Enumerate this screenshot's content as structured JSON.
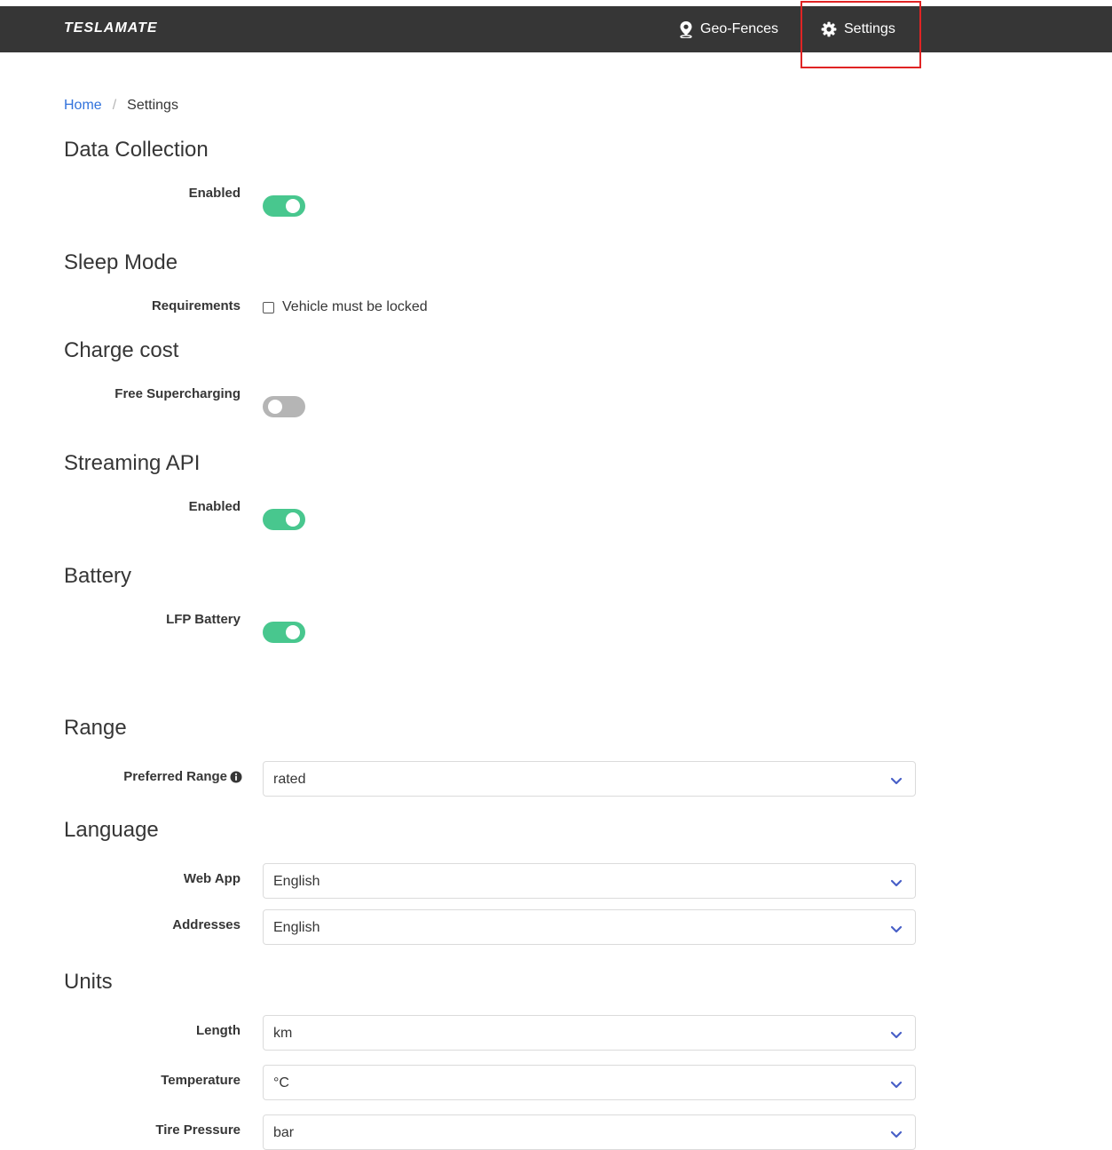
{
  "navbar": {
    "brand": "TESLAMATE",
    "geofences_label": "Geo-Fences",
    "settings_label": "Settings",
    "text_color": "#ffffff",
    "background": "#363636"
  },
  "breadcrumb": {
    "home": "Home",
    "separator": "/",
    "current": "Settings"
  },
  "sections": {
    "data_collection": {
      "title": "Data Collection",
      "enabled_label": "Enabled",
      "enabled": true
    },
    "sleep_mode": {
      "title": "Sleep Mode",
      "requirements_label": "Requirements",
      "vehicle_locked_label": "Vehicle must be locked",
      "vehicle_locked_checked": false
    },
    "charge_cost": {
      "title": "Charge cost",
      "free_supercharging_label": "Free Supercharging",
      "free_supercharging": false
    },
    "streaming_api": {
      "title": "Streaming API",
      "enabled_label": "Enabled",
      "enabled": true
    },
    "battery": {
      "title": "Battery",
      "lfp_label": "LFP Battery",
      "lfp": true
    },
    "range": {
      "title": "Range",
      "preferred_range_label": "Preferred Range",
      "preferred_range_value": "rated"
    },
    "language": {
      "title": "Language",
      "web_app_label": "Web App",
      "web_app_value": "English",
      "addresses_label": "Addresses",
      "addresses_value": "English"
    },
    "units": {
      "title": "Units",
      "length_label": "Length",
      "length_value": "km",
      "temperature_label": "Temperature",
      "temperature_value": "°C",
      "tire_pressure_label": "Tire Pressure",
      "tire_pressure_value": "bar"
    }
  },
  "colors": {
    "switch_on": "#48c78e",
    "switch_off": "#b5b5b5",
    "link": "#3273dc",
    "highlight": "#e02424",
    "chevron": "#485fc7"
  },
  "icons": {
    "geofences": "map-marker-icon",
    "settings": "gear-icon",
    "info": "info-circle-icon",
    "select": "chevron-down-icon"
  }
}
